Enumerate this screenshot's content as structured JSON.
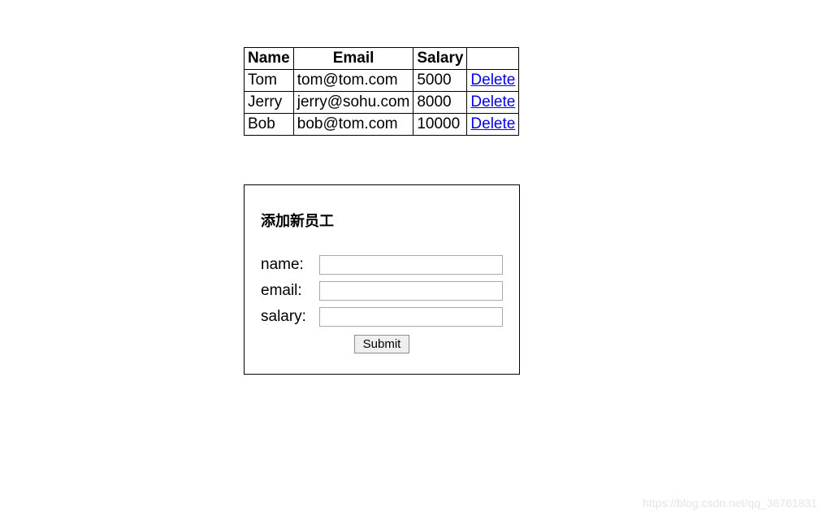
{
  "table": {
    "headers": [
      "Name",
      "Email",
      "Salary",
      ""
    ],
    "rows": [
      {
        "name": "Tom",
        "email": "tom@tom.com",
        "salary": "5000",
        "action": "Delete"
      },
      {
        "name": "Jerry",
        "email": "jerry@sohu.com",
        "salary": "8000",
        "action": "Delete"
      },
      {
        "name": "Bob",
        "email": "bob@tom.com",
        "salary": "10000",
        "action": "Delete"
      }
    ]
  },
  "form": {
    "title": "添加新员工",
    "name_label": "name:",
    "email_label": "email:",
    "salary_label": "salary:",
    "submit_label": "Submit",
    "name_value": "",
    "email_value": "",
    "salary_value": ""
  },
  "watermark": "https://blog.csdn.net/qq_36761831"
}
